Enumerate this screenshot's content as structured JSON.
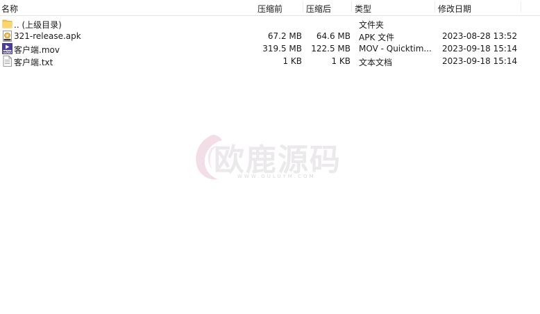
{
  "columns": {
    "name": "名称",
    "compressed_before": "压缩前",
    "compressed_after": "压缩后",
    "type": "类型",
    "modified": "修改日期"
  },
  "rows": [
    {
      "name": ".. (上级目录)",
      "before": "",
      "after": "",
      "type": "文件夹",
      "modified": "",
      "icon": "folder-icon"
    },
    {
      "name": "321-release.apk",
      "before": "67.2 MB",
      "after": "64.6 MB",
      "type": "APK 文件",
      "modified": "2023-08-28 13:52",
      "icon": "apk-file-icon"
    },
    {
      "name": "客户端.mov",
      "before": "319.5 MB",
      "after": "122.5 MB",
      "type": "MOV - Quicktim...",
      "modified": "2023-09-18 15:14",
      "icon": "mov-file-icon"
    },
    {
      "name": "客户端.txt",
      "before": "1 KB",
      "after": "1 KB",
      "type": "文本文档",
      "modified": "2023-09-18 15:14",
      "icon": "text-file-icon"
    }
  ],
  "watermark": {
    "text": "欧鹿源码",
    "subtext": "WWW.OULUYM.COM"
  },
  "colors": {
    "folder": "#f7c752",
    "mov_badge": "#4a3aa8",
    "watermark_logo": "#f3dde6"
  }
}
